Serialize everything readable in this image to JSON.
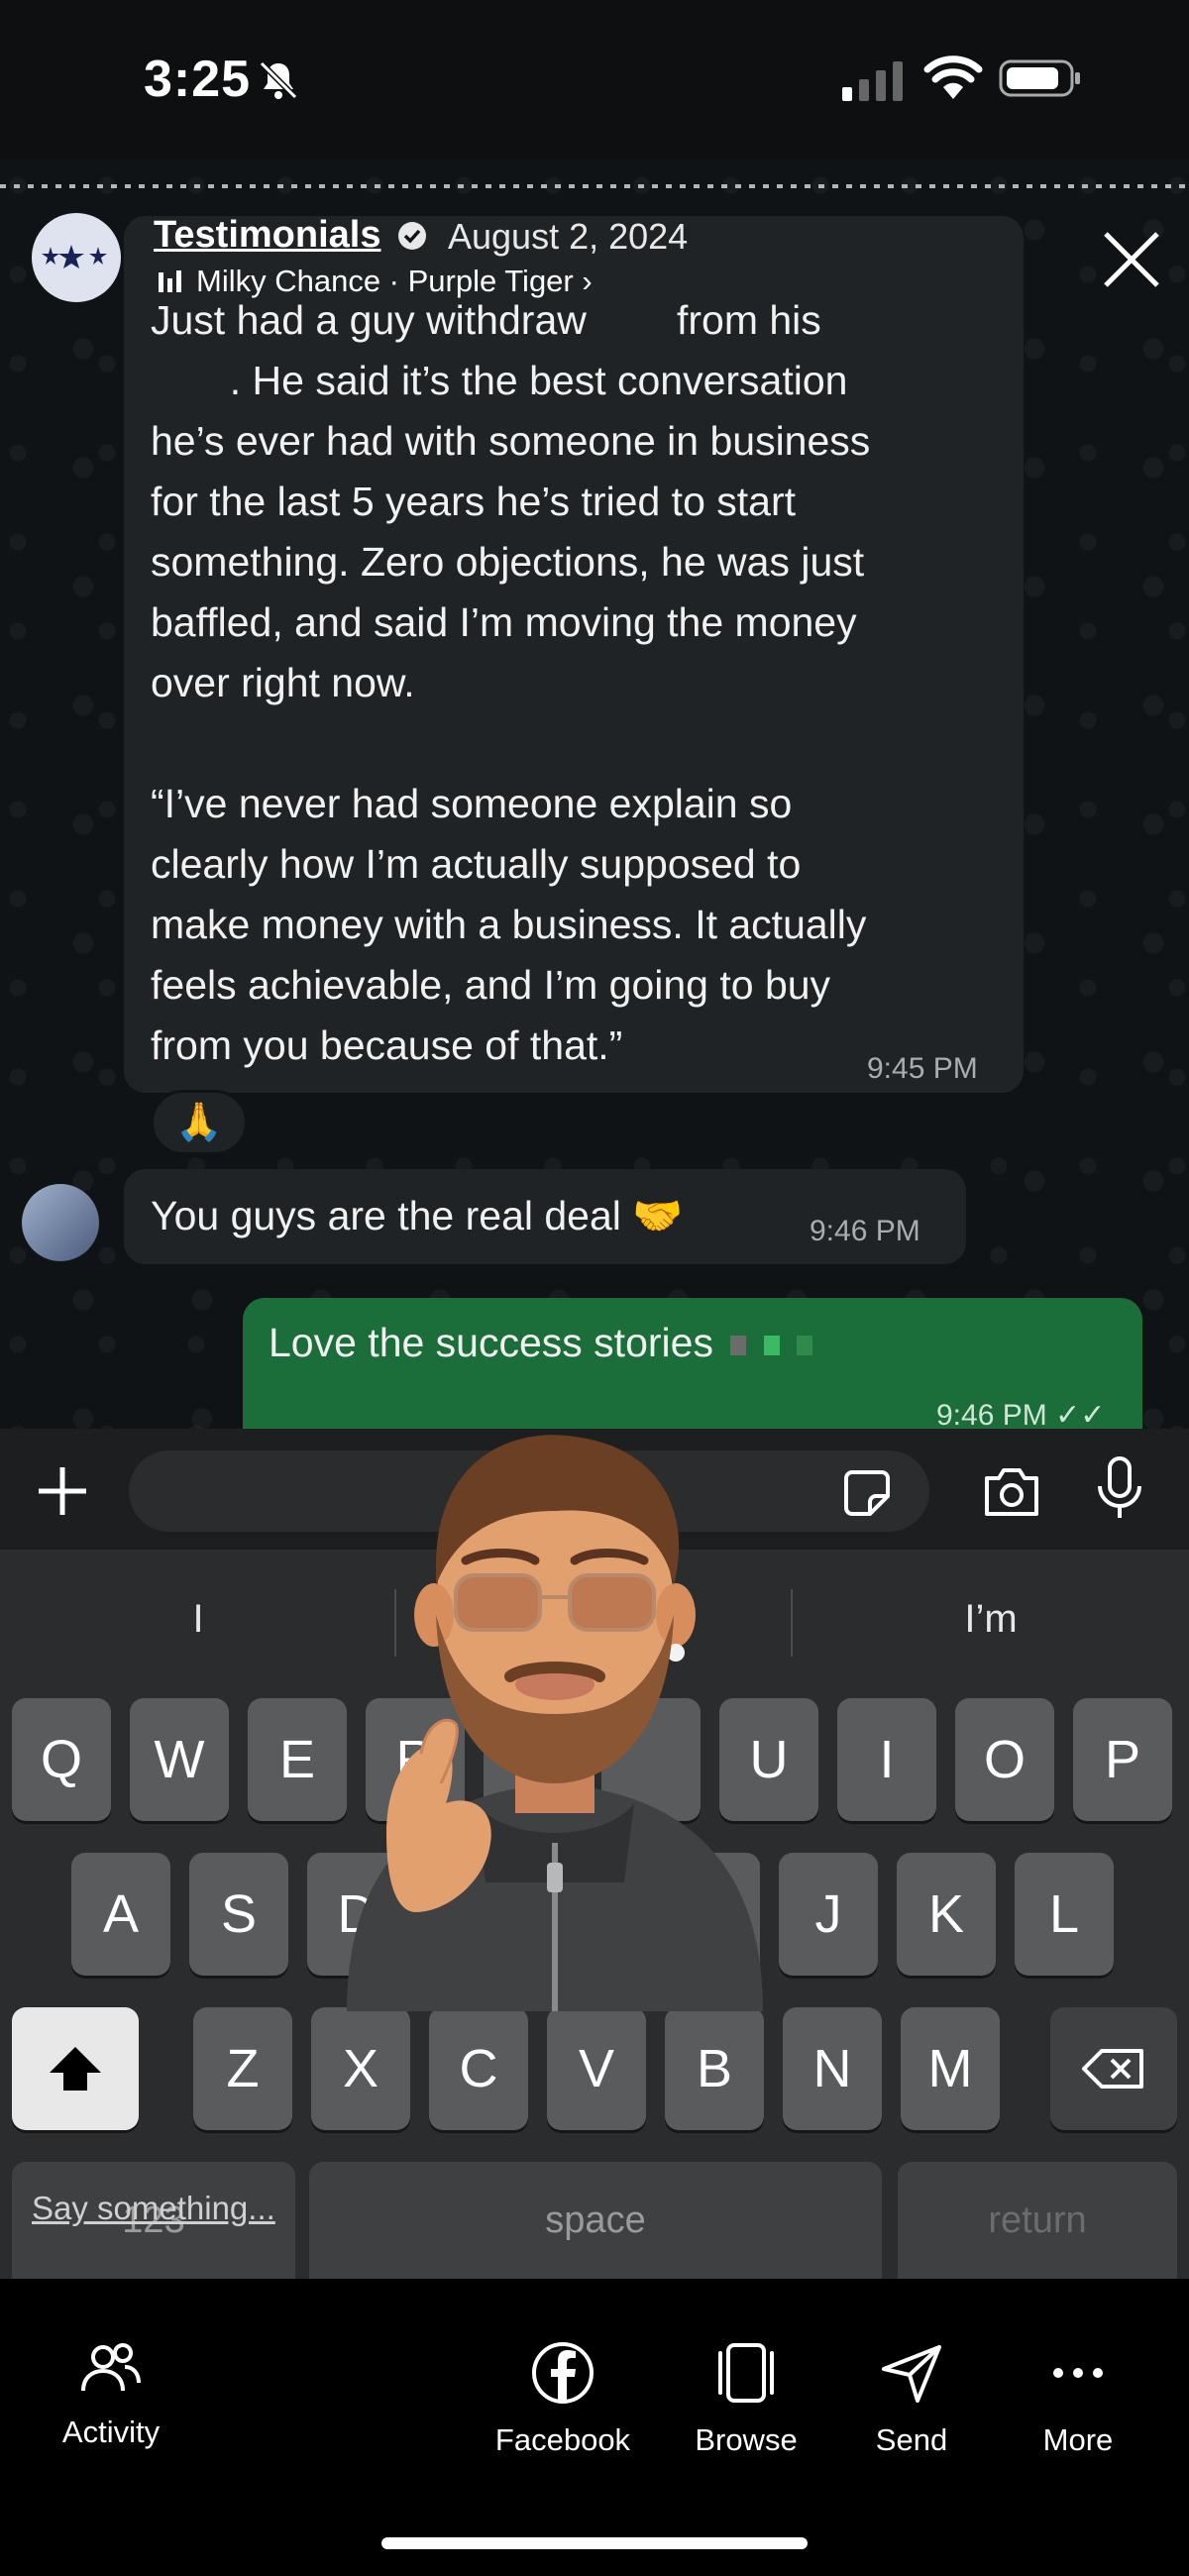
{
  "status_bar": {
    "time": "3:25"
  },
  "story_header": {
    "title": "Testimonials",
    "date": "August 2, 2024",
    "music": "Milky Chance · Purple Tiger ›"
  },
  "messages": {
    "msg1_text": "Just had a guy withdraw        from his\n       . He said it’s the best conversation\nhe’s ever had with someone in business\nfor the last 5 years he’s tried to start\nsomething. Zero objections, he was just\nbaffled, and said I’m moving the money\nover right now.\n\n“I’ve never had someone explain so\nclearly how I’m actually supposed to\nmake money with a business. It actually\nfeels achievable, and I’m going to buy\nfrom you because of that.”",
    "msg1_time": "9:45 PM",
    "reaction": "🙏",
    "msg2_text": "You guys are the real deal 🤝",
    "msg2_time": "9:46 PM",
    "msg3_text": "Love the success stories",
    "msg3_time": "9:46 PM ✓✓"
  },
  "keyboard": {
    "suggestions": [
      "I",
      "",
      "I’m"
    ],
    "row1": [
      "Q",
      "W",
      "E",
      "R",
      "",
      "",
      "U",
      "I",
      "O",
      "P"
    ],
    "row2": [
      "A",
      "S",
      "D",
      "",
      "",
      "",
      "J",
      "K",
      "L"
    ],
    "row3": [
      "Z",
      "X",
      "C",
      "V",
      "B",
      "N",
      "M"
    ],
    "numbers_key": "123",
    "space_key": "space",
    "return_key": "return"
  },
  "reply_placeholder": "Say something...",
  "bottom_nav": {
    "activity": "Activity",
    "facebook": "Facebook",
    "browse": "Browse",
    "send": "Send",
    "more": "More"
  }
}
